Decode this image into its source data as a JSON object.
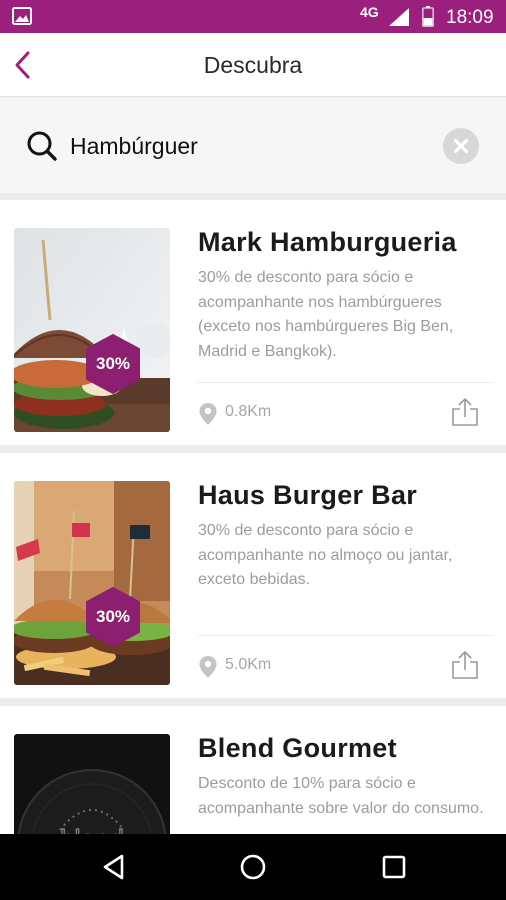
{
  "status_bar": {
    "network": "4G",
    "time": "18:09"
  },
  "header": {
    "title": "Descubra"
  },
  "search": {
    "value": "Hambúrguer",
    "placeholder": ""
  },
  "results": [
    {
      "title": "Mark Hamburgueria",
      "description": "30% de desconto para sócio e acompanhante nos hambúrgueres (exceto nos hambúrgueres Big Ben, Madrid e Bangkok).",
      "discount": "30%",
      "distance": "0.8Km",
      "image": "burger-photo"
    },
    {
      "title": "Haus Burger Bar",
      "description": "30% de desconto para sócio e acompanhante no almoço ou jantar, exceto bebidas.",
      "discount": "30%",
      "distance": "5.0Km",
      "image": "burger-fries-photo"
    },
    {
      "title": "Blend Gourmet",
      "description": "Desconto de 10% para sócio e acompanhante sobre valor do consumo.",
      "image": "blend-logo",
      "logo_text": "blend"
    }
  ],
  "colors": {
    "accent": "#9b1f7c",
    "title_text": "#1b1b1b",
    "muted_text": "#9c9c9c",
    "nav_bar": "#000000"
  },
  "icons": [
    "image-icon",
    "signal-icon",
    "battery-icon",
    "back-arrow-icon",
    "search-icon",
    "clear-icon",
    "location-pin-icon",
    "share-icon",
    "nav-back-icon",
    "nav-home-icon",
    "nav-recents-icon"
  ]
}
